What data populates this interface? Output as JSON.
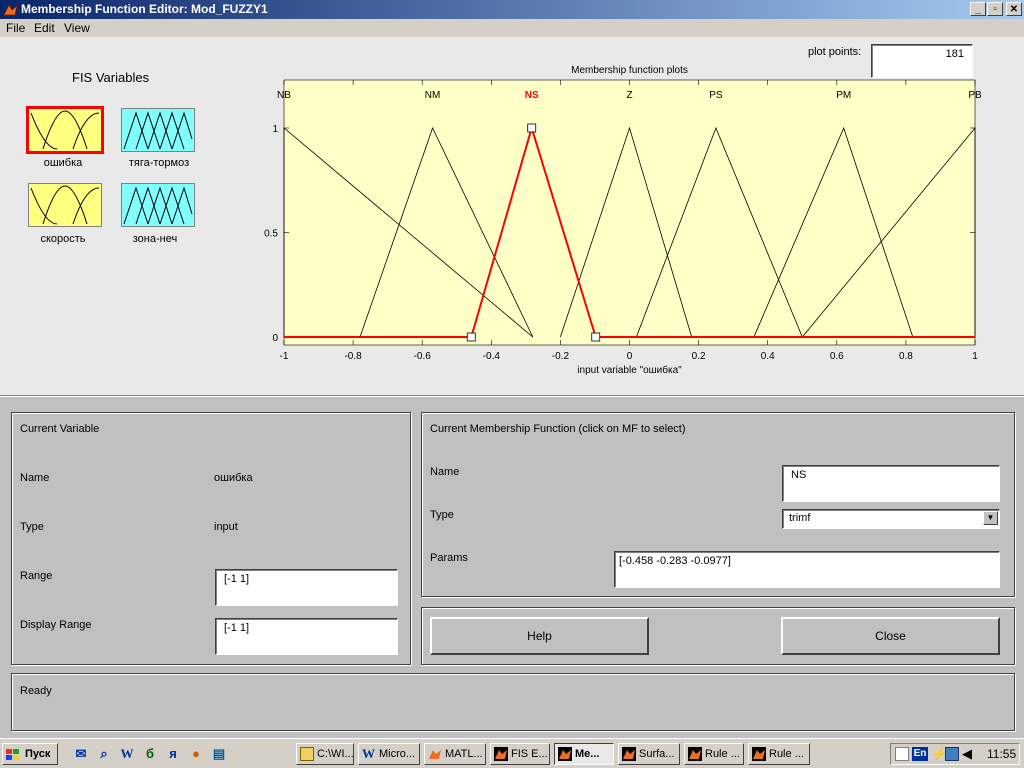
{
  "window": {
    "title": "Membership Function Editor: Mod_FUZZY1",
    "minimize_label": "_",
    "maximize_label": "▫",
    "close_label": "✕"
  },
  "menu": {
    "items": [
      "File",
      "Edit",
      "View"
    ]
  },
  "plot_points": {
    "label": "plot points:",
    "value": "181"
  },
  "fis_variables": {
    "title": "FIS Variables",
    "items": [
      {
        "label": "ошибка",
        "color": "#ffff80",
        "selected": true
      },
      {
        "label": "тяга-тормоз",
        "color": "#80ffff",
        "selected": false
      },
      {
        "label": "скорость",
        "color": "#ffff80",
        "selected": false
      },
      {
        "label": "зона-неч",
        "color": "#80ffff",
        "selected": false
      }
    ]
  },
  "chart_data": {
    "type": "line",
    "title": "Membership function plots",
    "xlabel": "input variable \"ошибка\"",
    "ylabel": "",
    "xlim": [
      -1,
      1
    ],
    "ylim": [
      0,
      1
    ],
    "x_ticks": [
      "-1",
      "-0.8",
      "-0.6",
      "-0.4",
      "-0.2",
      "0",
      "0.2",
      "0.4",
      "0.6",
      "0.8",
      "1"
    ],
    "y_ticks": [
      "0",
      "0.5",
      "1"
    ],
    "background": "#ffffc8",
    "selected_color": "#ff0000",
    "series": [
      {
        "name": "NB",
        "params": [
          -1.0,
          -1.0,
          -0.28
        ],
        "selected": false
      },
      {
        "name": "NM",
        "params": [
          -0.78,
          -0.57,
          -0.28
        ],
        "selected": false
      },
      {
        "name": "NS",
        "params": [
          -0.458,
          -0.283,
          -0.0977
        ],
        "selected": true
      },
      {
        "name": "Z",
        "params": [
          -0.2,
          0.0,
          0.18
        ],
        "selected": false
      },
      {
        "name": "PS",
        "params": [
          0.02,
          0.25,
          0.5
        ],
        "selected": false
      },
      {
        "name": "PM",
        "params": [
          0.36,
          0.62,
          0.82
        ],
        "selected": false
      },
      {
        "name": "PB",
        "params": [
          0.5,
          1.0,
          1.0
        ],
        "selected": false
      }
    ]
  },
  "current_variable": {
    "title": "Current Variable",
    "name_label": "Name",
    "name_value": "ошибка",
    "type_label": "Type",
    "type_value": "input",
    "range_label": "Range",
    "range_value": "[-1 1]",
    "display_range_label": "Display Range",
    "display_range_value": "[-1 1]"
  },
  "current_mf": {
    "title": "Current Membership Function (click on MF to select)",
    "name_label": "Name",
    "name_value": "NS",
    "type_label": "Type",
    "type_value": "trimf",
    "params_label": "Params",
    "params_value": "[-0.458 -0.283 -0.0977]"
  },
  "buttons": {
    "help": "Help",
    "close": "Close"
  },
  "status": "Ready",
  "taskbar": {
    "start": "Пуск",
    "tasks": [
      {
        "label": "C:\\WI...",
        "active": false
      },
      {
        "label": "Micro...",
        "active": false
      },
      {
        "label": "MATL...",
        "active": false
      },
      {
        "label": "FIS E...",
        "active": false
      },
      {
        "label": "Me...",
        "active": true
      },
      {
        "label": "Surfa...",
        "active": false
      },
      {
        "label": "Rule ...",
        "active": false
      },
      {
        "label": "Rule ...",
        "active": false
      }
    ],
    "lang": "En",
    "clock": "11:55"
  }
}
